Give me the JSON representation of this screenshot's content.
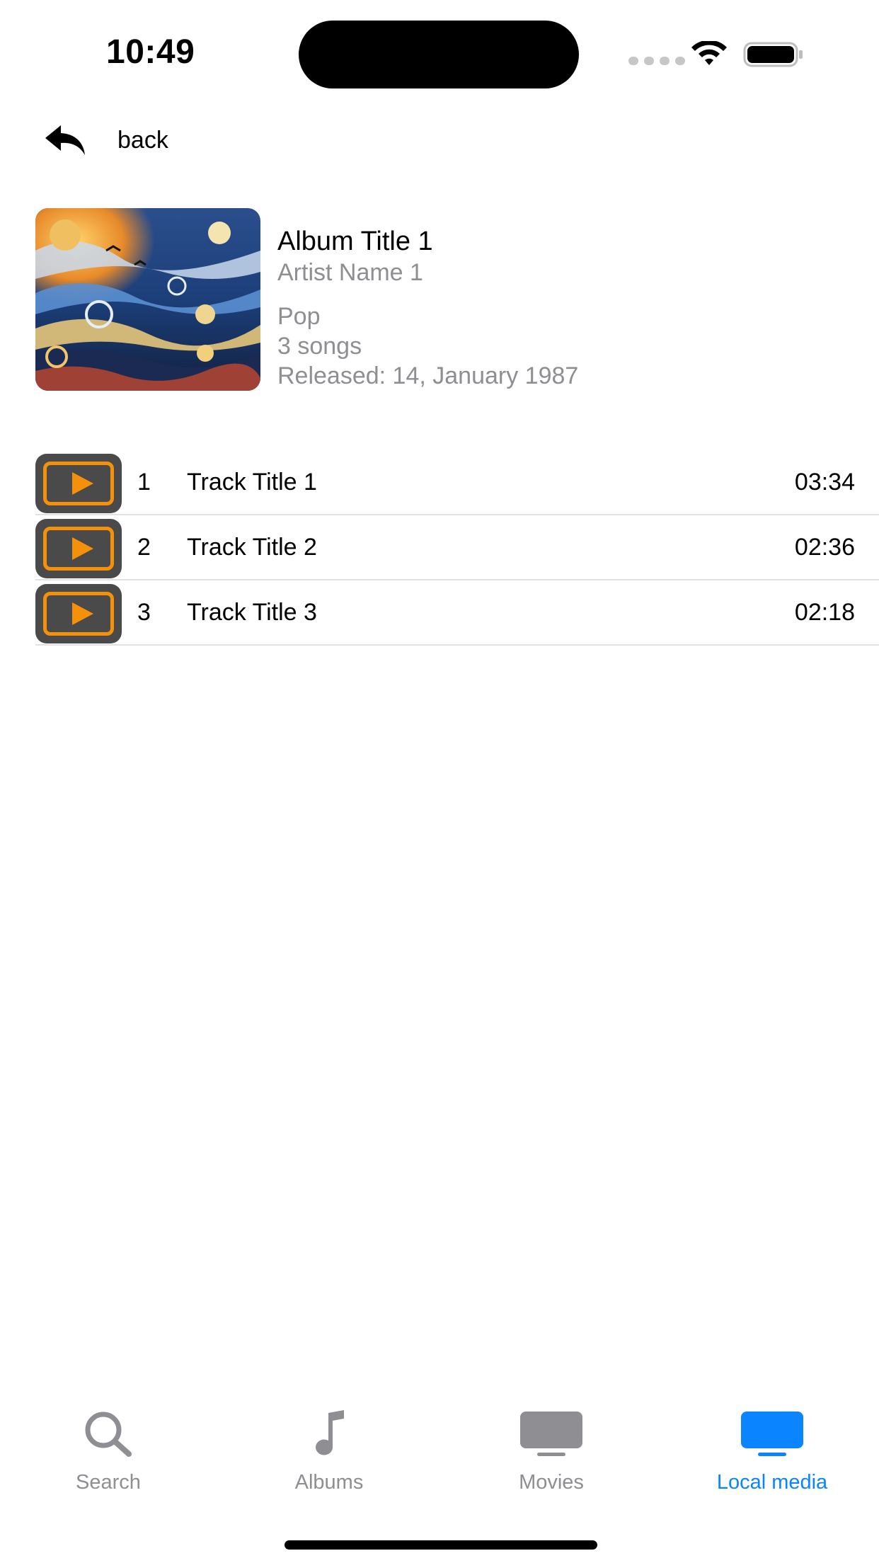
{
  "status_bar": {
    "time": "10:49"
  },
  "nav": {
    "back_label": "back"
  },
  "album": {
    "title": "Album Title 1",
    "artist": "Artist Name 1",
    "genre": "Pop",
    "song_count": "3 songs",
    "released": "Released: 14, January 1987"
  },
  "tracks": [
    {
      "number": "1",
      "title": "Track Title 1",
      "duration": "03:34"
    },
    {
      "number": "2",
      "title": "Track Title 2",
      "duration": "02:36"
    },
    {
      "number": "3",
      "title": "Track Title 3",
      "duration": "02:18"
    }
  ],
  "tabs": [
    {
      "label": "Search",
      "icon": "search-icon"
    },
    {
      "label": "Albums",
      "icon": "music-note-icon"
    },
    {
      "label": "Movies",
      "icon": "tv-icon"
    },
    {
      "label": "Local media",
      "icon": "tv-icon",
      "active": true
    }
  ],
  "colors": {
    "accent": "#0a84ff",
    "play_button_bg": "#4a4a4a",
    "play_button_accent": "#f5900a",
    "secondary_text": "#8e8e93"
  }
}
